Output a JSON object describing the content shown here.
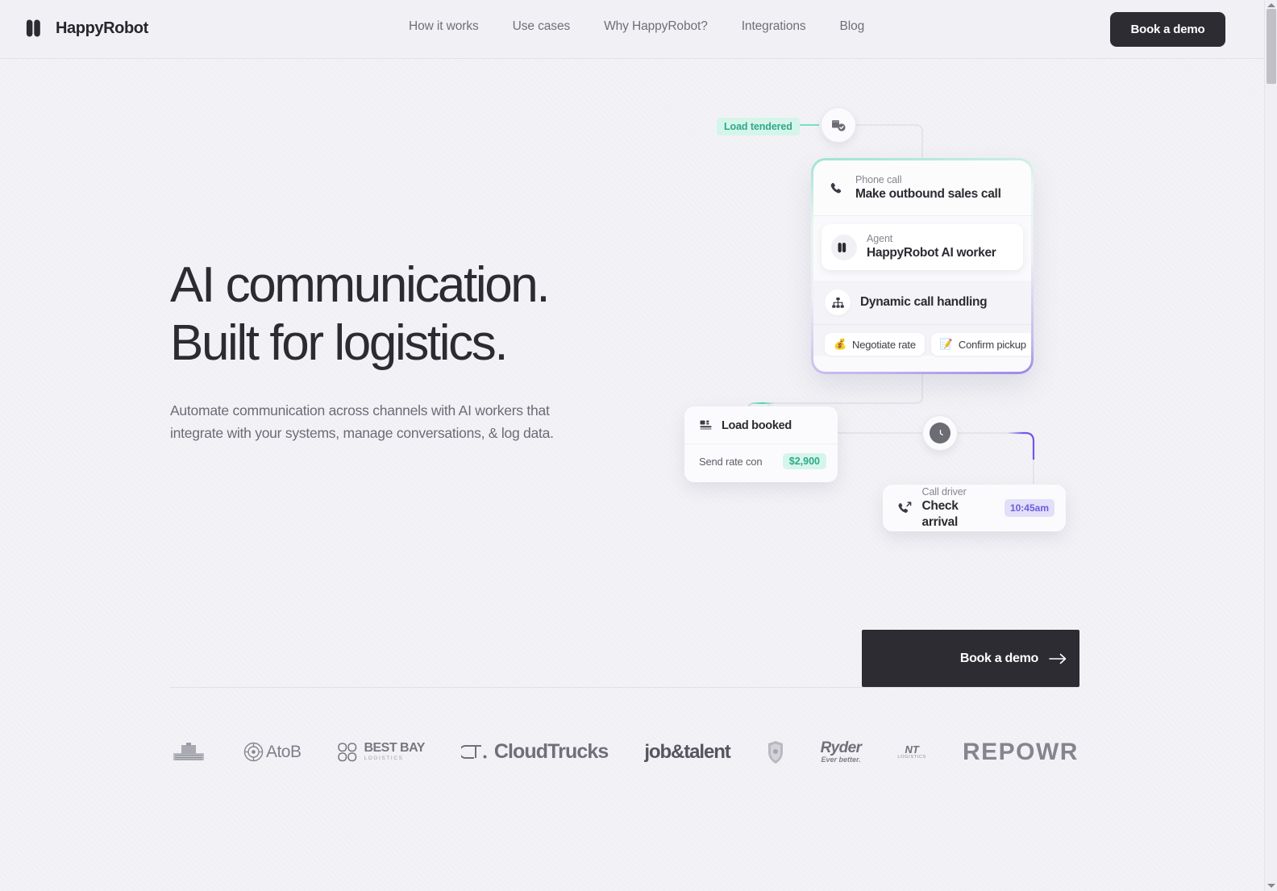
{
  "brand": {
    "name": "HappyRobot",
    "logo_icon": "happyrobot-logo-icon"
  },
  "nav": {
    "items": [
      {
        "label": "How it works"
      },
      {
        "label": "Use cases"
      },
      {
        "label": "Why HappyRobot?"
      },
      {
        "label": "Integrations"
      },
      {
        "label": "Blog"
      }
    ],
    "cta_label": "Book a demo"
  },
  "hero": {
    "headline_line1": "AI communication.",
    "headline_line2": "Built for logistics.",
    "subtext": "Automate communication across channels with AI workers that integrate with your systems, manage conversations, & log data."
  },
  "illustration": {
    "tendered_badge": "Load tendered",
    "tender_node_icon": "package-check-icon",
    "clock_node_icon": "clock-icon",
    "call_card": {
      "phone_label": "Phone call",
      "phone_title": "Make outbound sales call",
      "phone_icon": "phone-icon",
      "agent_label": "Agent",
      "agent_title": "HappyRobot AI worker",
      "agent_icon": "happyrobot-avatar-icon",
      "handling_title": "Dynamic call handling",
      "handling_icon": "sitemap-icon",
      "chips": [
        {
          "emoji": "💰",
          "label": "Negotiate rate",
          "icon": "money-bag-icon"
        },
        {
          "emoji": "📝",
          "label": "Confirm pickup",
          "icon": "memo-icon"
        }
      ]
    },
    "booked_card": {
      "title": "Load booked",
      "icon": "load-booked-icon",
      "row_key": "Send rate con",
      "row_value": "$2,900"
    },
    "driver_card": {
      "label": "Call driver",
      "title": "Check arrival",
      "time": "10:45am",
      "icon": "outbound-call-icon"
    },
    "accent_teal": "#2ea98a",
    "accent_purple": "#6c5ce0"
  },
  "cta": {
    "label": "Book a demo",
    "arrow_icon": "arrow-right-icon"
  },
  "logos": [
    {
      "name": "Penske Logistics",
      "kind": "image"
    },
    {
      "name": "AtoB",
      "kind": "text",
      "text": "AtoB"
    },
    {
      "name": "Best Bay Logistics",
      "kind": "text",
      "text": "BEST BAY",
      "sub": "LOGISTICS"
    },
    {
      "name": "CloudTrucks",
      "kind": "text",
      "text": "CloudTrucks"
    },
    {
      "name": "job&talent",
      "kind": "text",
      "text": "job&talent"
    },
    {
      "name": "Shield brand",
      "kind": "image"
    },
    {
      "name": "Ryder",
      "kind": "text",
      "text": "Ryder",
      "sub": "Ever better."
    },
    {
      "name": "NT Logistics",
      "kind": "text",
      "text": "NT",
      "sub": "LOGISTICS"
    },
    {
      "name": "REPOWR",
      "kind": "text",
      "text": "REPOWR"
    }
  ]
}
